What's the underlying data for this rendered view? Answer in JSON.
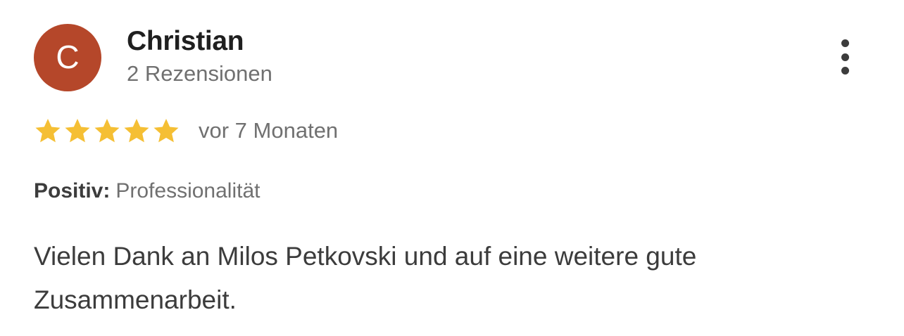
{
  "review": {
    "author": {
      "name": "Christian",
      "initial": "C",
      "avatar_color": "#b5472a",
      "review_count_label": "2 Rezensionen"
    },
    "rating": {
      "value": 5,
      "max": 5,
      "star_color": "#f5bf34"
    },
    "date_label": "vor 7 Monaten",
    "attribute": {
      "label": "Positiv:",
      "value": "Professionalität"
    },
    "text": "Vielen Dank an Milos Petkovski und auf eine weitere gute Zusammenarbeit.",
    "more_icon": "more-vertical-icon"
  }
}
